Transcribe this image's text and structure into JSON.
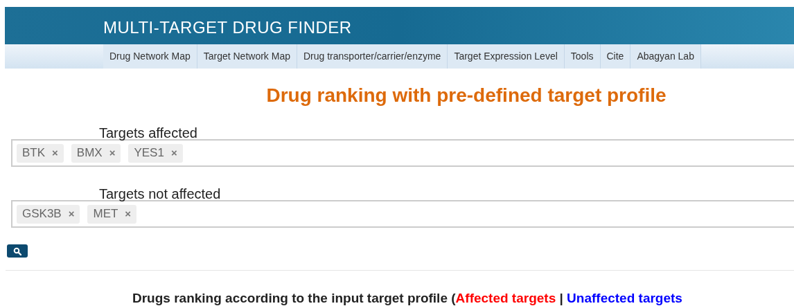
{
  "header": {
    "title": "MULTI-TARGET DRUG FINDER"
  },
  "nav": [
    {
      "label": "Drug Network Map"
    },
    {
      "label": "Target Network Map"
    },
    {
      "label": "Drug transporter/carrier/enzyme"
    },
    {
      "label": "Target Expression Level"
    },
    {
      "label": "Tools"
    },
    {
      "label": "Cite"
    },
    {
      "label": "Abagyan Lab"
    }
  ],
  "page_title": "Drug ranking with pre-defined target profile",
  "fields": [
    {
      "label": "Targets affected",
      "tags": [
        "BTK",
        "BMX",
        "YES1"
      ]
    },
    {
      "label": "Targets not affected",
      "tags": [
        "GSK3B",
        "MET"
      ]
    }
  ],
  "remove_mark": "×",
  "results_heading": [
    {
      "text": "Drugs ranking according to the input target profile (",
      "color": "#222222"
    },
    {
      "text": "Affected targets",
      "color": "#ff0000"
    },
    {
      "text": " | ",
      "color": "#222222"
    },
    {
      "text": "Unaffected targets",
      "color": "#0000ff"
    }
  ]
}
